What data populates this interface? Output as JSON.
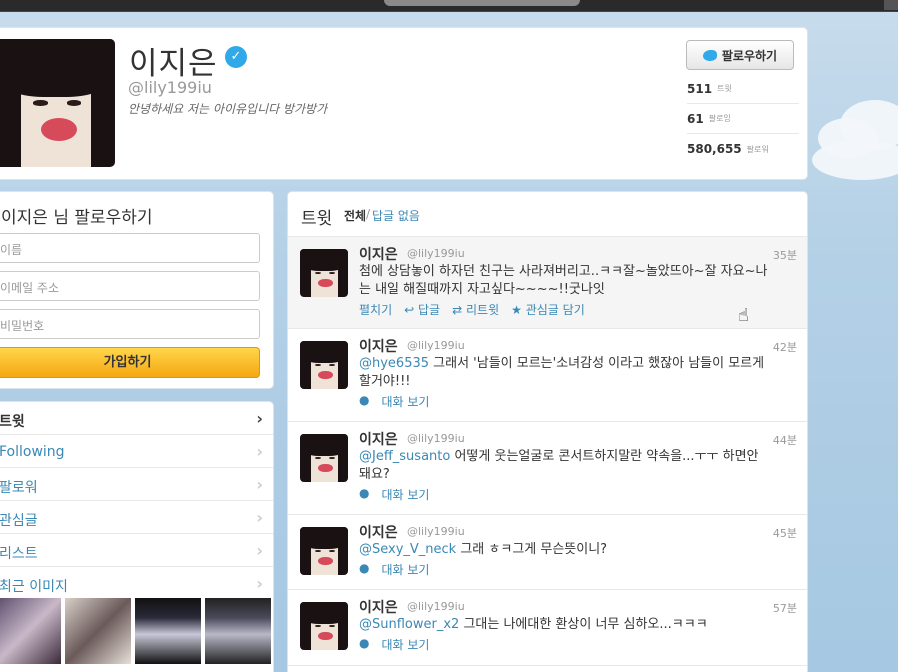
{
  "profile": {
    "name": "이지은",
    "handle": "@lily199iu",
    "bio": "안녕하세요 저는 아이유입니다 방가방가",
    "follow_label": "팔로우하기",
    "stats": [
      {
        "num": "511",
        "label": "트윗"
      },
      {
        "num": "61",
        "label": "팔로잉"
      },
      {
        "num": "580,655",
        "label": "팔로워"
      }
    ]
  },
  "signup": {
    "title": "이지은 님 팔로우하기",
    "name_placeholder": "이름",
    "email_placeholder": "이메일 주소",
    "password_placeholder": "비밀번호",
    "join_label": "가입하기"
  },
  "nav": {
    "items": [
      {
        "label": "트윗"
      },
      {
        "label": "Following"
      },
      {
        "label": "팔로워"
      },
      {
        "label": "관심글"
      },
      {
        "label": "리스트"
      },
      {
        "label": "최근 이미지"
      }
    ]
  },
  "timeline": {
    "title": "트윗",
    "filter_all": "전체",
    "filter_sep": "/",
    "filter_noreply": "답글 없음",
    "tweets": [
      {
        "name": "이지은",
        "handle": "@lily199iu",
        "time": "35분",
        "text": "첨에 상담놓이 하자던 친구는 사라져버리고..ㅋㅋ잘~놀았뜨아~잘 자요~나는 내일 해질때까지 자고싶다~~~~!!굿나잇",
        "actions": [
          "펼치기",
          "답글",
          "리트윗",
          "관심글 담기"
        ]
      },
      {
        "name": "이지은",
        "handle": "@lily199iu",
        "time": "42분",
        "mention": "@hye6535",
        "text": " 그래서 '남들이 모르는'소녀감성 이라고 했잖아 남들이 모르게 할거야!!!",
        "action": "대화 보기"
      },
      {
        "name": "이지은",
        "handle": "@lily199iu",
        "time": "44분",
        "mention": "@Jeff_susanto",
        "text": " 어떻게 웃는얼굴로 콘서트하지말란 약속을...ㅜㅜ 하면안돼요?",
        "action": "대화 보기"
      },
      {
        "name": "이지은",
        "handle": "@lily199iu",
        "time": "45분",
        "mention": "@Sexy_V_neck",
        "text": " 그래 ㅎㅋ그게 무슨뜻이니?",
        "action": "대화 보기"
      },
      {
        "name": "이지은",
        "handle": "@lily199iu",
        "time": "57분",
        "mention": "@Sunflower_x2",
        "text": " 그대는 나에대한 환상이 너무 심하오...ㅋㅋㅋ",
        "action": "대화 보기"
      }
    ]
  },
  "colors": {
    "link": "#3a88b5",
    "verified": "#2fa9e8",
    "join_button": "#f5a712"
  }
}
